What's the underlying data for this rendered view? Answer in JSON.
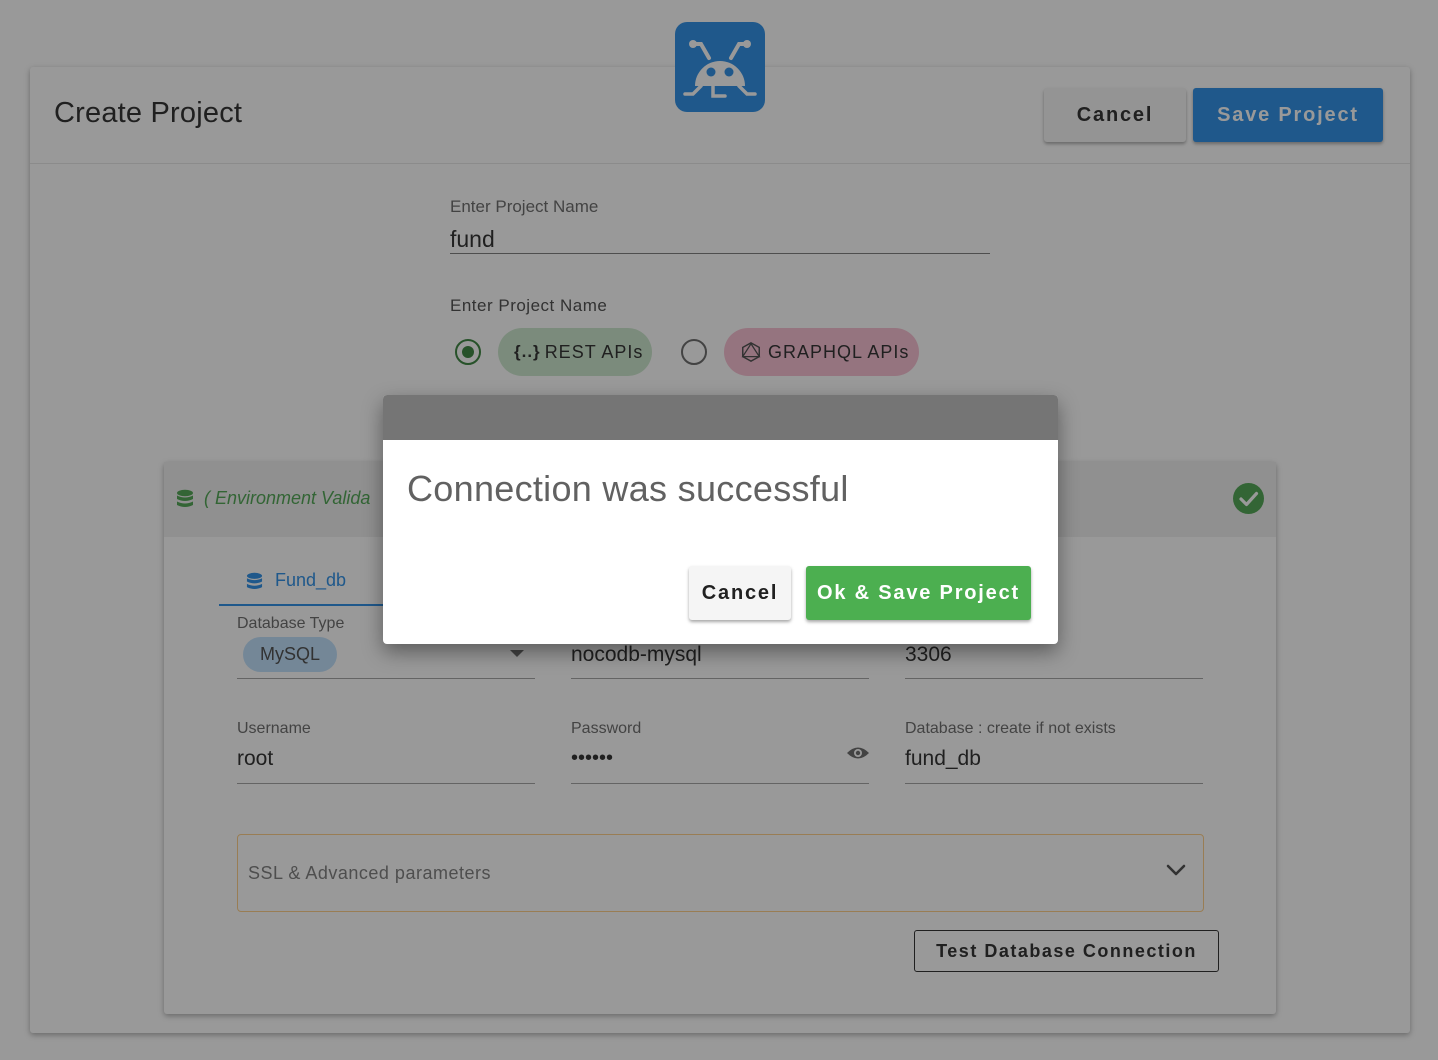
{
  "header": {
    "title": "Create Project",
    "cancel_label": "Cancel",
    "save_label": "Save Project"
  },
  "project_form": {
    "name_label": "Enter Project Name",
    "name_value": "fund",
    "api_type_label": "Enter Project Name",
    "api_options": [
      {
        "label": "REST APIs",
        "icon": "curly-braces-icon",
        "selected": true
      },
      {
        "label": "GRAPHQL APIs",
        "icon": "graphql-icon",
        "selected": false
      }
    ]
  },
  "environment": {
    "title": "( Environment Valida",
    "status": "validated",
    "tab_label": "Fund_db",
    "fields": {
      "database_type_label": "Database Type",
      "database_type_value": "MySQL",
      "host_value": "nocodb-mysql",
      "port_value": "3306",
      "username_label": "Username",
      "username_value": "root",
      "password_label": "Password",
      "password_value": "••••••",
      "database_label": "Database : create if not exists",
      "database_value": "fund_db"
    },
    "ssl_label": "SSL & Advanced parameters",
    "test_button_label": "Test Database Connection"
  },
  "dialog": {
    "message": "Connection was successful",
    "cancel_label": "Cancel",
    "ok_label": "Ok & Save Project"
  },
  "colors": {
    "primary": "#1e88e5",
    "success": "#4caf50",
    "rest_chip": "#c8e6c9",
    "graphql_chip": "#f8bbd0"
  }
}
